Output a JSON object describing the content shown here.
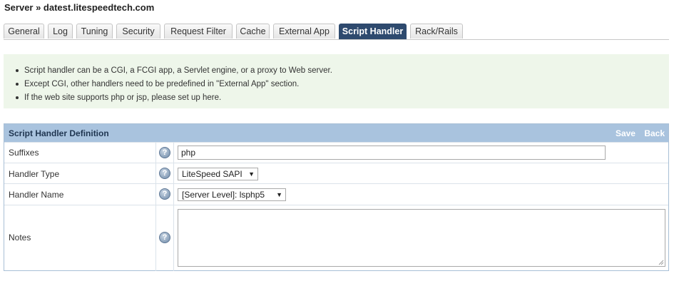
{
  "breadcrumb": "Server » datest.litespeedtech.com",
  "tabs": [
    {
      "label": "General",
      "active": false
    },
    {
      "label": "Log",
      "active": false
    },
    {
      "label": "Tuning",
      "active": false
    },
    {
      "label": "Security",
      "active": false
    },
    {
      "label": "Request Filter",
      "active": false
    },
    {
      "label": "Cache",
      "active": false
    },
    {
      "label": "External App",
      "active": false
    },
    {
      "label": "Script Handler",
      "active": true
    },
    {
      "label": "Rack/Rails",
      "active": false
    }
  ],
  "info": {
    "items": [
      "Script handler can be a CGI, a FCGI app, a Servlet engine, or a proxy to Web server.",
      "Except CGI, other handlers need to be predefined in \"External App\" section.",
      "If the web site supports php or jsp, please set up here."
    ]
  },
  "panel": {
    "title": "Script Handler Definition",
    "save_label": "Save",
    "back_label": "Back"
  },
  "fields": {
    "suffixes": {
      "label": "Suffixes",
      "value": "php"
    },
    "handler_type": {
      "label": "Handler Type",
      "value": "LiteSpeed SAPI"
    },
    "handler_name": {
      "label": "Handler Name",
      "value": "[Server Level]: lsphp5"
    },
    "notes": {
      "label": "Notes",
      "value": ""
    }
  },
  "icons": {
    "help": "help-icon",
    "dropdown": "chevron-down-icon"
  },
  "colors": {
    "active_tab": "#2e4a6e",
    "panel_header": "#a9c3de",
    "info_background": "#eef6ea",
    "header_action_text": "#ffffff"
  }
}
